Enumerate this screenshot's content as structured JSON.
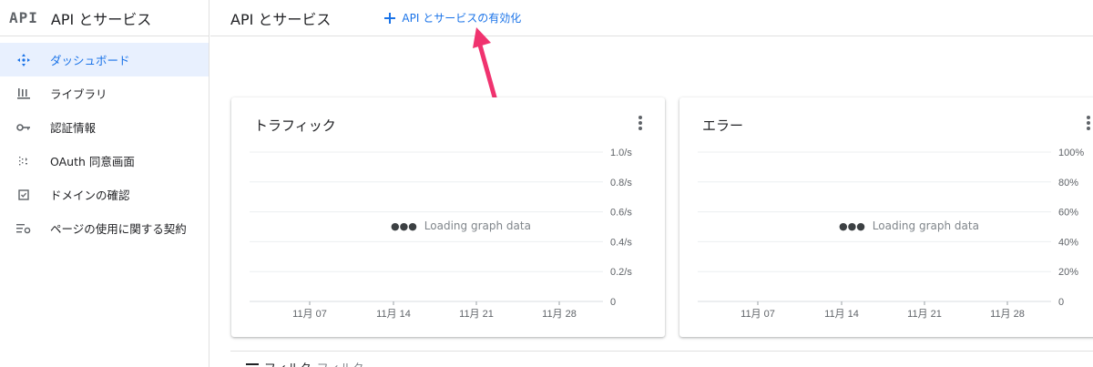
{
  "sidebar": {
    "logo": "API",
    "title": "API とサービス",
    "items": [
      {
        "label": "ダッシュボード",
        "icon": "dashboard-icon",
        "active": true
      },
      {
        "label": "ライブラリ",
        "icon": "library-icon"
      },
      {
        "label": "認証情報",
        "icon": "key-icon"
      },
      {
        "label": "OAuth 同意画面",
        "icon": "consent-icon"
      },
      {
        "label": "ドメインの確認",
        "icon": "checkbox-icon"
      },
      {
        "label": "ページの使用に関する契約",
        "icon": "settings-list-icon"
      }
    ]
  },
  "header": {
    "title": "API とサービス",
    "enable_label": "API とサービスの有効化"
  },
  "colors": {
    "accent": "#1a73e8",
    "annotation_arrow": "#f0336f"
  },
  "traffic_card": {
    "title": "トラフィック",
    "loading": "Loading graph data",
    "chart_data": {
      "type": "line",
      "title": "トラフィック",
      "x_ticks": [
        "11月 07",
        "11月 14",
        "11月 21",
        "11月 28"
      ],
      "y_ticks": [
        "1.0/s",
        "0.8/s",
        "0.6/s",
        "0.4/s",
        "0.2/s",
        "0"
      ],
      "ylim": [
        0,
        1.0
      ],
      "series": []
    }
  },
  "errors_card": {
    "title": "エラー",
    "loading": "Loading graph data",
    "chart_data": {
      "type": "line",
      "title": "エラー",
      "x_ticks": [
        "11月 07",
        "11月 14",
        "11月 21",
        "11月 28"
      ],
      "y_ticks": [
        "100%",
        "80%",
        "60%",
        "40%",
        "20%",
        "0"
      ],
      "ylim": [
        0,
        100
      ],
      "series": []
    }
  },
  "filter": {
    "label": "フィルタ",
    "placeholder": "フィルタ"
  }
}
